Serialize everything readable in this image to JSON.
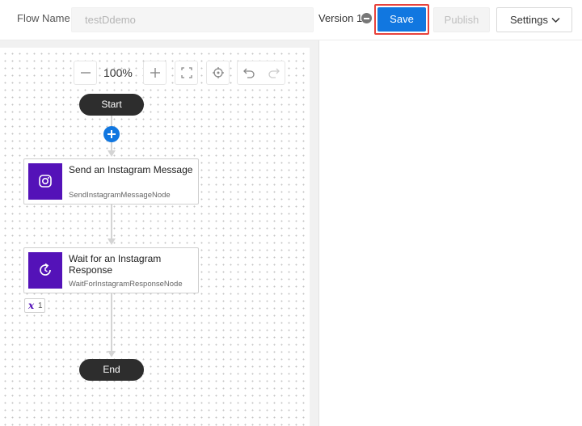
{
  "header": {
    "flow_name_label": "Flow Name",
    "flow_name_value": "testDdemo",
    "version_label": "Version 1",
    "save_label": "Save",
    "publish_label": "Publish",
    "settings_label": "Settings"
  },
  "toolbar": {
    "zoom_level": "100%"
  },
  "flow": {
    "start_label": "Start",
    "end_label": "End",
    "nodes": [
      {
        "title": "Send an Instagram Message",
        "subtitle": "SendInstagramMessageNode",
        "icon": "instagram-icon"
      },
      {
        "title": "Wait for an Instagram Response",
        "subtitle": "WaitForInstagramResponseNode",
        "icon": "wait-refresh-icon"
      }
    ],
    "variable_badge": {
      "symbol": "x",
      "count": "1"
    }
  },
  "colors": {
    "primary": "#1177e0",
    "node_icon": "#5412b8",
    "highlight": "#e8423c",
    "pill": "#2d2d2d"
  }
}
